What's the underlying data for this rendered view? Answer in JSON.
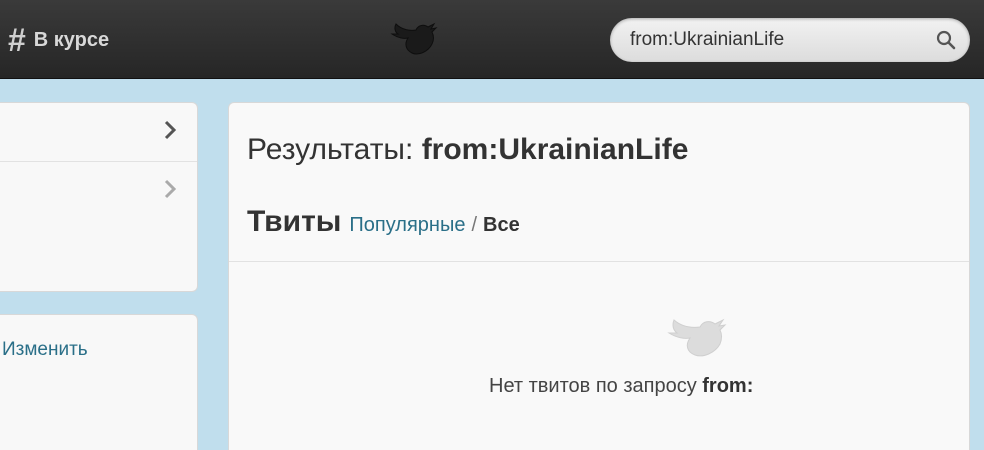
{
  "topbar": {
    "nav_icon": "hash-icon",
    "nav_label": "В курсе",
    "logo": "twitter-bird-icon"
  },
  "search": {
    "value": "from:UkrainianLife",
    "button_icon": "magnifier-icon"
  },
  "sidebar": {
    "rows": [
      {
        "icon": "chevron-right-icon"
      },
      {
        "icon": "chevron-right-icon"
      }
    ],
    "edit_label": "Изменить"
  },
  "main": {
    "results_label": "Результаты:",
    "query": "from:UkrainianLife",
    "tweets_label": "Твиты",
    "tab_popular": "Популярные",
    "tab_separator": "/",
    "tab_all": "Все",
    "empty_icon": "twitter-bird-icon",
    "empty_text": "Нет твитов по запросу",
    "empty_query": "from:"
  },
  "colors": {
    "topbar": "#2e2e2e",
    "background": "#c0deed",
    "link": "#2a6f88"
  }
}
